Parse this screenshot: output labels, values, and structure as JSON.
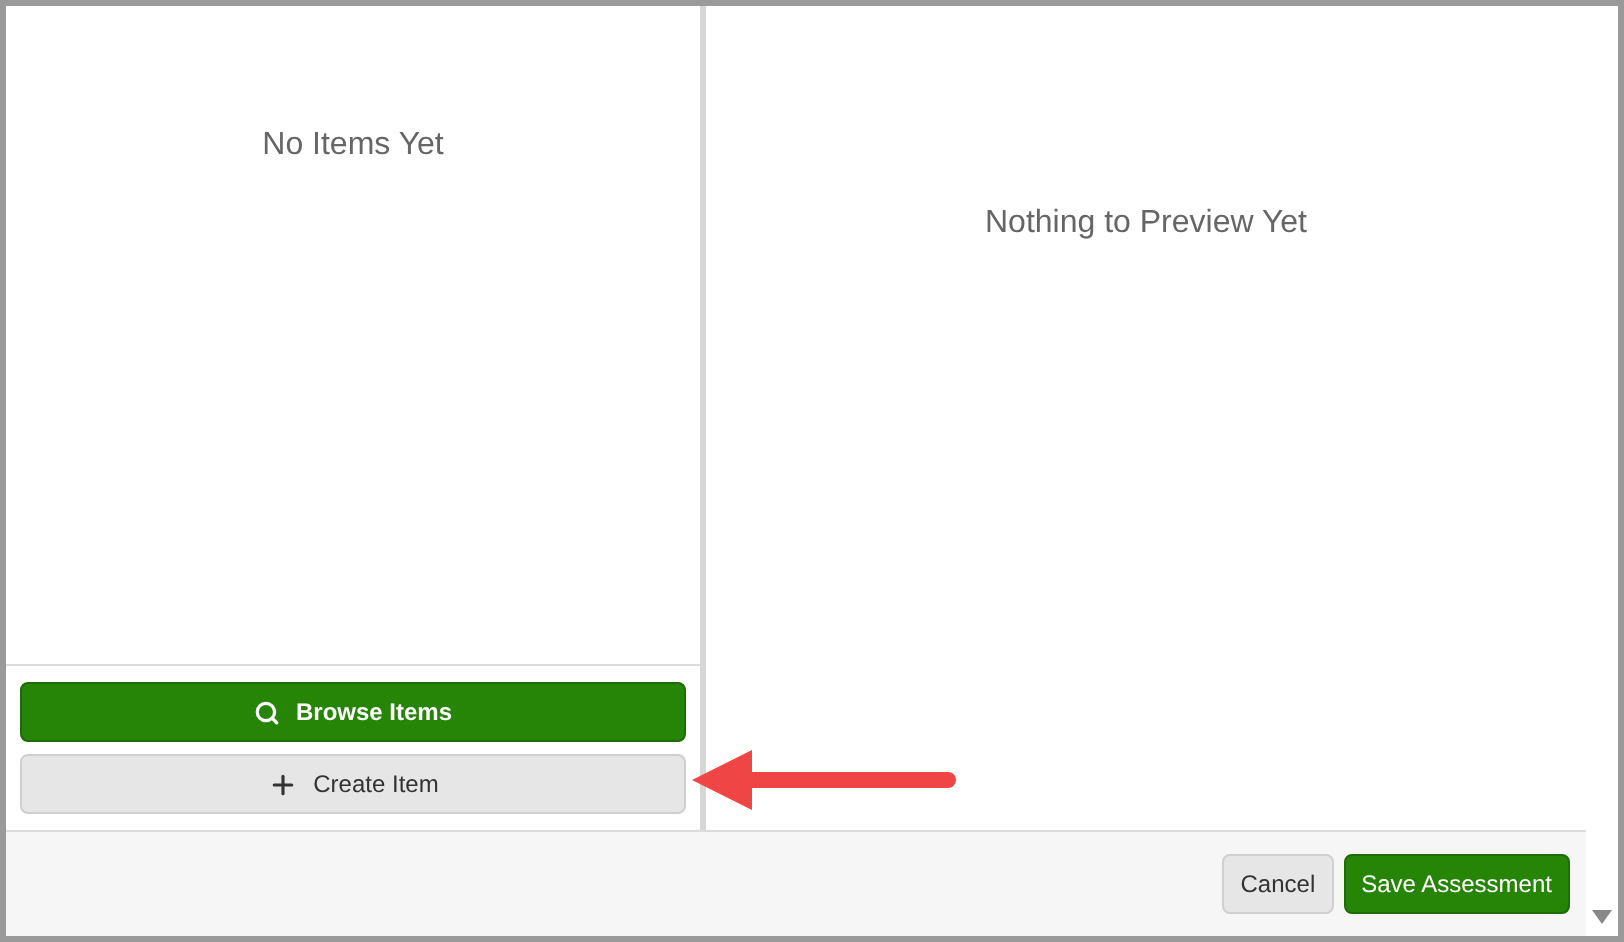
{
  "item_list": {
    "empty_message": "No Items Yet"
  },
  "item_actions": [
    {
      "label": "Browse Items",
      "kind": "primary"
    },
    {
      "label": "Create Item",
      "kind": "secondary"
    }
  ],
  "preview": {
    "empty_message": "Nothing to Preview Yet"
  },
  "footer_buttons": [
    {
      "label": "Cancel",
      "kind": "secondary"
    },
    {
      "label": "Save Assessment",
      "kind": "primary"
    }
  ]
}
